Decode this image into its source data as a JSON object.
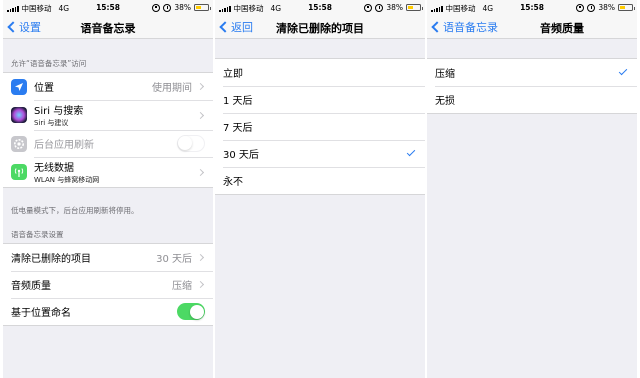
{
  "status_bar": {
    "carrier": "中国移动",
    "network": "4G",
    "time": "15:58",
    "battery": "38%",
    "battery_color": "#ffcc00"
  },
  "panel1": {
    "back_label": "设置",
    "title": "语音备忘录",
    "access_header": "允许“语音备忘录”访问",
    "items": [
      {
        "label": "位置",
        "value": "使用期间",
        "icon": "location-arrow-icon",
        "icon_bg": "#2a7cf0"
      },
      {
        "label": "Siri 与搜索",
        "sub": "Siri 与建议",
        "icon": "siri-icon",
        "icon_bg": "#1c1c3a"
      },
      {
        "label": "后台应用刷新",
        "icon": "gear-icon",
        "icon_bg": "#c7c7cc",
        "toggle": "off-disabled"
      },
      {
        "label": "无线数据",
        "sub": "WLAN 与蜂窝移动网",
        "icon": "antenna-icon",
        "icon_bg": "#4cd964"
      }
    ],
    "low_power_note": "低电量模式下，后台应用刷新将停用。",
    "settings_header": "语音备忘录设置",
    "settings": [
      {
        "label": "清除已删除的项目",
        "value": "30 天后"
      },
      {
        "label": "音频质量",
        "value": "压缩"
      },
      {
        "label": "基于位置命名",
        "toggle": "on"
      }
    ]
  },
  "panel2": {
    "back_label": "返回",
    "title": "清除已删除的项目",
    "options": [
      "立即",
      "1 天后",
      "7 天后",
      "30 天后",
      "永不"
    ],
    "selected": "30 天后"
  },
  "panel3": {
    "back_label": "语音备忘录",
    "title": "音频质量",
    "options": [
      "压缩",
      "无损"
    ],
    "selected": "压缩"
  },
  "colors": {
    "accent": "#2a7cf0",
    "switch_on": "#4cd964",
    "background": "#efeff4"
  }
}
